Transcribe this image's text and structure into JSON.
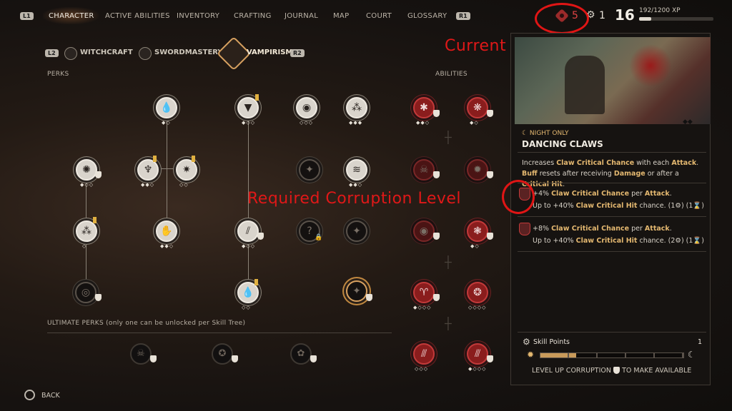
{
  "nav": {
    "left_hint": "L1",
    "right_hint": "R1",
    "items": [
      "CHARACTER",
      "ACTIVE ABILITIES",
      "INVENTORY",
      "CRAFTING",
      "JOURNAL",
      "MAP",
      "COURT",
      "GLOSSARY"
    ],
    "active": "CHARACTER"
  },
  "status": {
    "corruption_level": "5",
    "skill_points": "1",
    "character_level": "16",
    "xp_text": "192/1200 XP",
    "xp_fraction": 0.16
  },
  "annotations": {
    "current_corruption": "Current Corruption Level",
    "required_corruption": "Required Corruption Level"
  },
  "trees": {
    "left_hint": "L2",
    "right_hint": "R2",
    "tabs": [
      "WITCHCRAFT",
      "SWORDMASTERY",
      "VAMPIRISM"
    ],
    "active": "VAMPIRISM"
  },
  "sections": {
    "perks": "PERKS",
    "abilities": "ABILITIES",
    "ultimate": "ULTIMATE PERKS (only one can be unlocked per Skill Tree)"
  },
  "icons": [
    "corruption-icon",
    "gear-icon",
    "shield-icon",
    "sun-icon",
    "moon-icon",
    "warning-icon",
    "lock-icon"
  ],
  "ability": {
    "tag": "☾ NIGHT ONLY",
    "name": "DANCING CLAWS",
    "desc_parts": [
      "Increases ",
      "Claw Critical Chance",
      " with each ",
      "Attack",
      ". ",
      "Buff",
      " resets after receiving ",
      "Damage",
      " or after a ",
      "Critical Hit",
      "."
    ],
    "tier1": {
      "line1_parts": [
        "+4% ",
        "Claw Critical Chance",
        " per ",
        "Attack",
        "."
      ],
      "line2_parts": [
        "Up to +40% ",
        "Claw Critical Hit",
        " chance. ",
        "(1⚙) (1⌛)"
      ]
    },
    "tier2": {
      "line1_parts": [
        "+8% ",
        "Claw Critical Chance",
        " per ",
        "Attack",
        "."
      ],
      "line2_parts": [
        "Up to +40% ",
        "Claw Critical Hit",
        " chance. ",
        "(2⚙) (1⌛)"
      ]
    }
  },
  "skill_points": {
    "label": "Skill Points",
    "value": "1",
    "corruption_fraction": 0.25,
    "level_up_text_a": "LEVEL UP CORRUPTION",
    "level_up_text_b": "TO MAKE AVAILABLE"
  },
  "footer": {
    "back_label": "BACK"
  },
  "colors": {
    "accent_gold": "#e4b870",
    "corruption_red": "#e04444",
    "annotation_red": "#e01818"
  }
}
